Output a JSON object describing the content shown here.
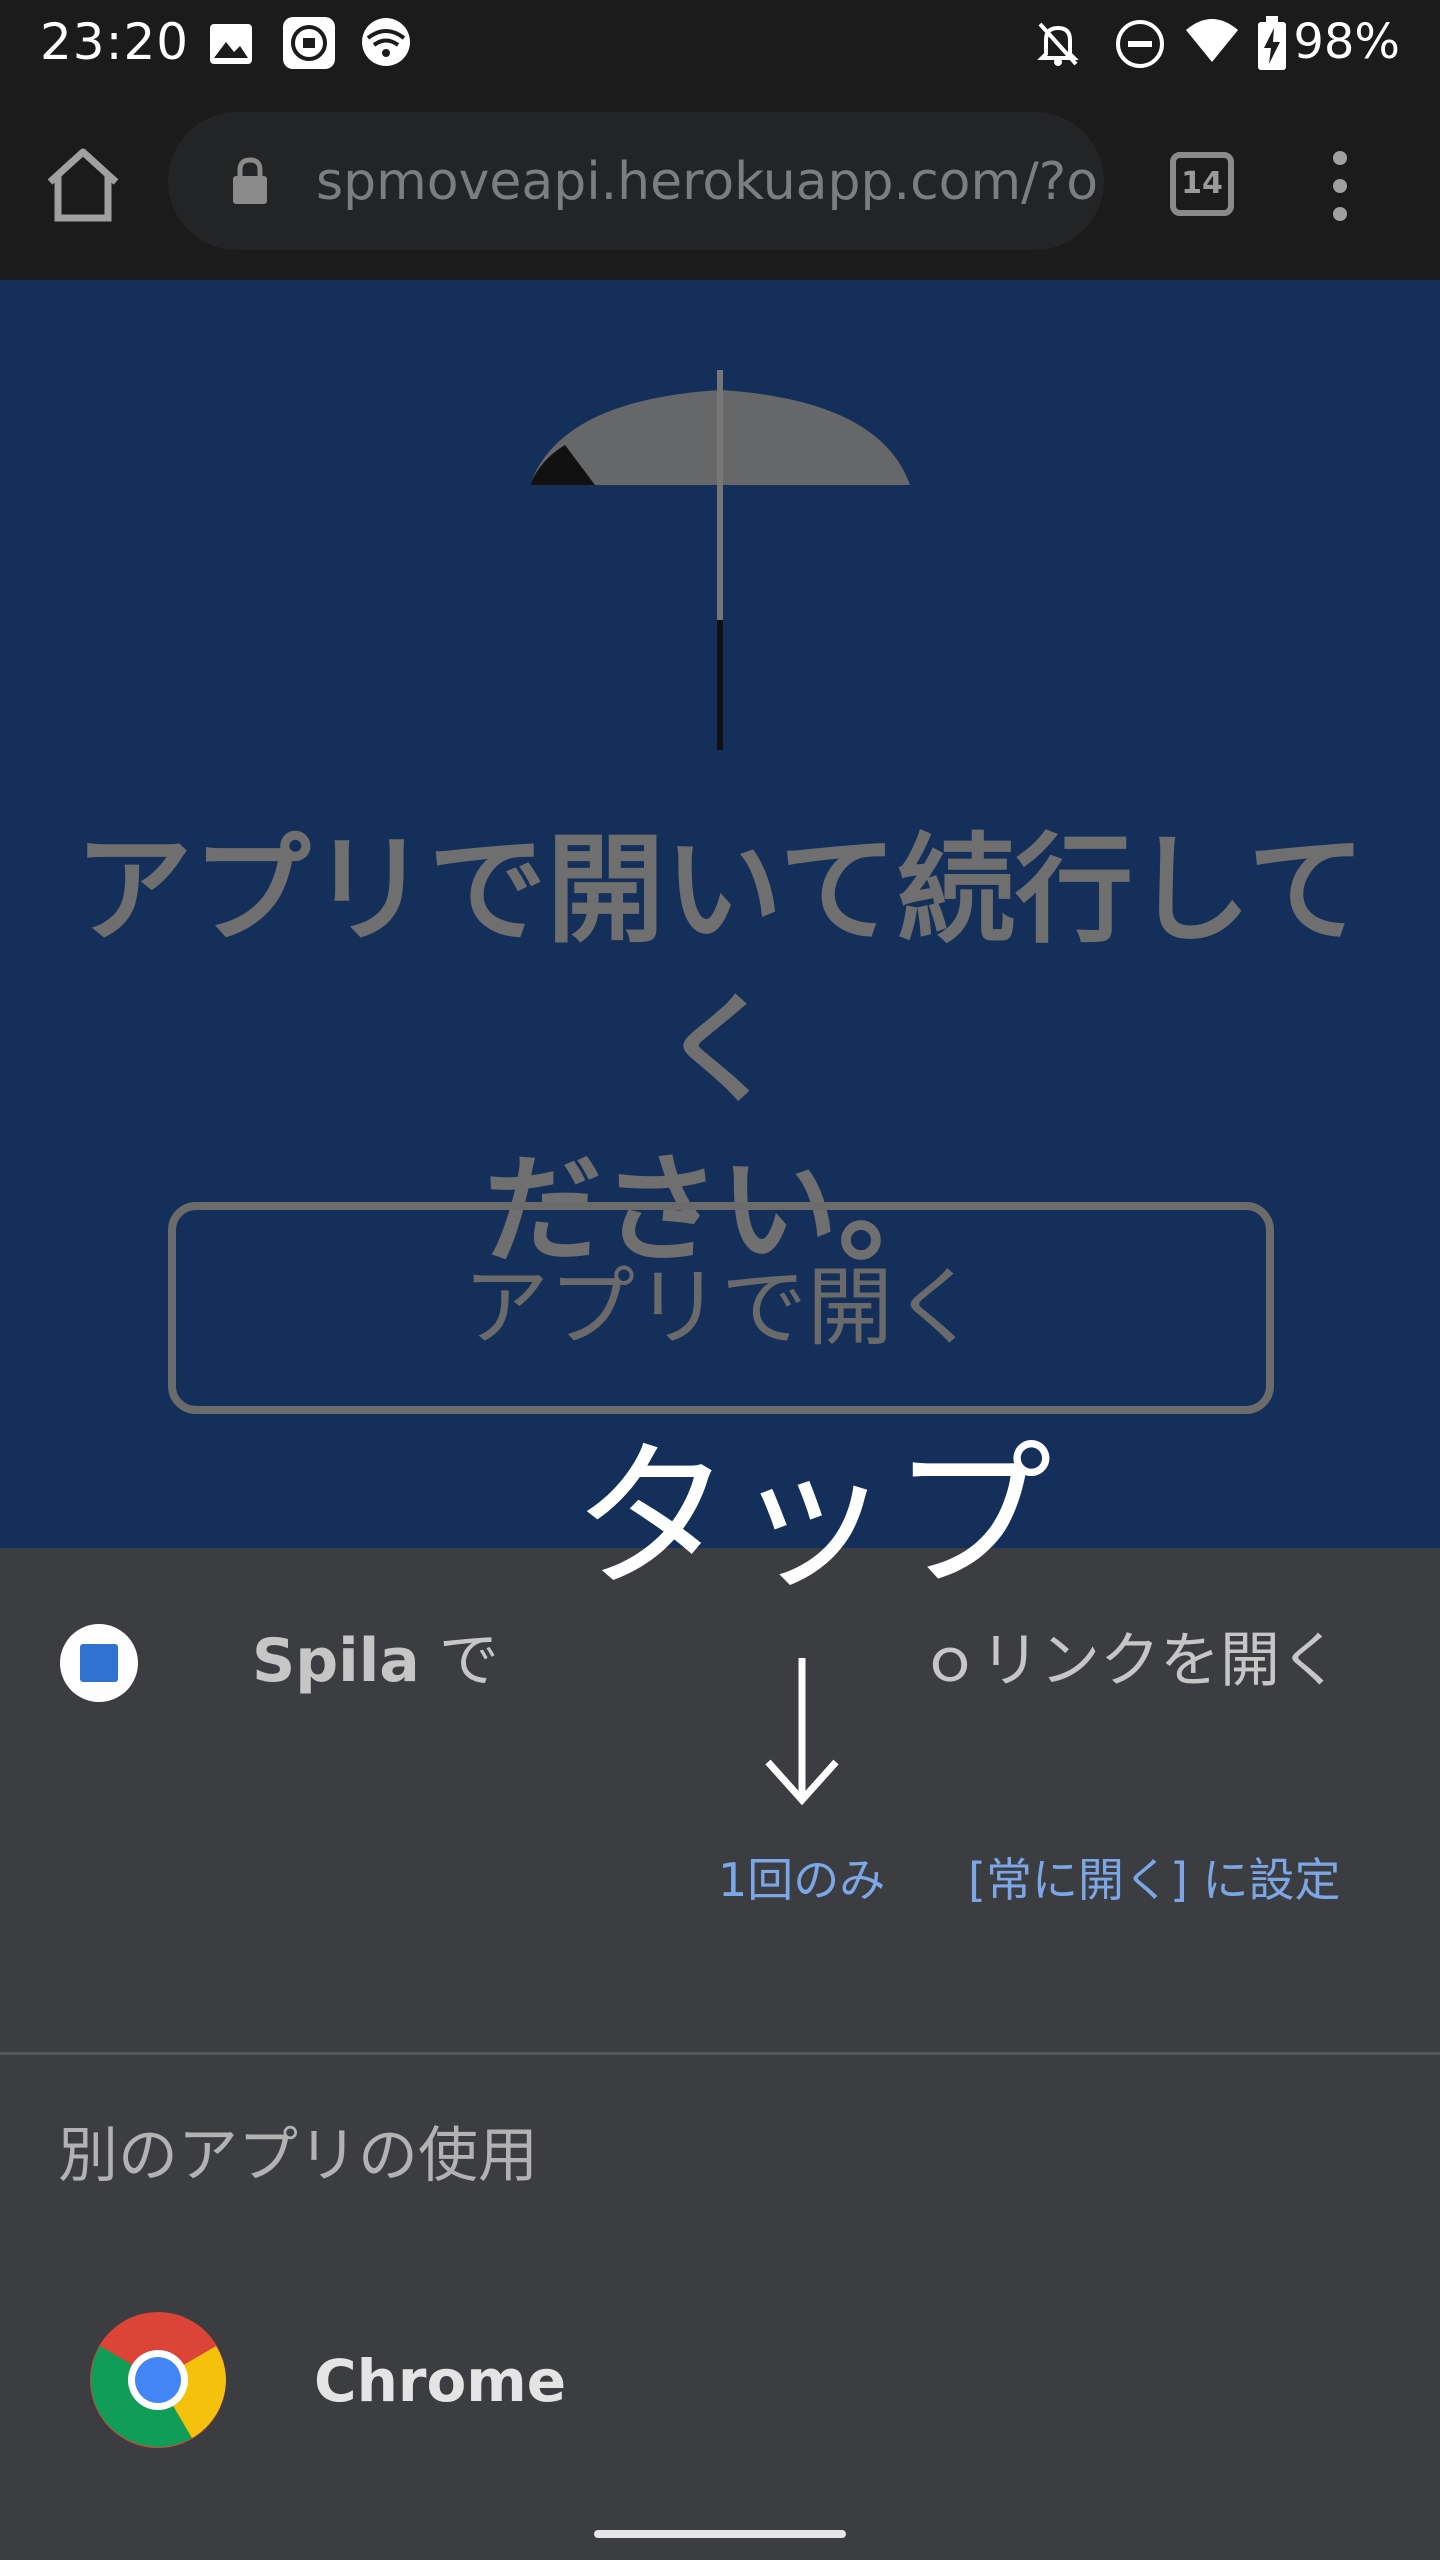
{
  "status_bar": {
    "time": "23:20",
    "battery": "98%",
    "left_icons": [
      "gallery-icon",
      "mi-icon",
      "wifi-icon"
    ],
    "right_icons": [
      "notifications-off-icon",
      "do-not-disturb-icon",
      "wifi-icon",
      "battery-charging-icon"
    ]
  },
  "browser": {
    "url": "spmoveapi.herokuapp.com/?o",
    "tab_count": "14"
  },
  "page": {
    "heading_line1": "アプリで開いて続行してく",
    "heading_line2": "ださい。",
    "open_app_button": "アプリで開く"
  },
  "sheet": {
    "app_name": "Spila",
    "open_with_prefix": " で",
    "open_with_tail": "ｏリンクを開く",
    "once_button": "1回のみ",
    "always_button": "[常に開く] に設定",
    "other_apps_label": "別のアプリの使用",
    "other_app_name": "Chrome"
  },
  "annotation": {
    "tap_label": "タップ",
    "arrow": "↓"
  },
  "colors": {
    "page_bg": "#14305a",
    "sheet_bg": "#3b3d40",
    "accent_link": "#7ba7e6",
    "toolbar_bg": "#1b1b1c"
  }
}
